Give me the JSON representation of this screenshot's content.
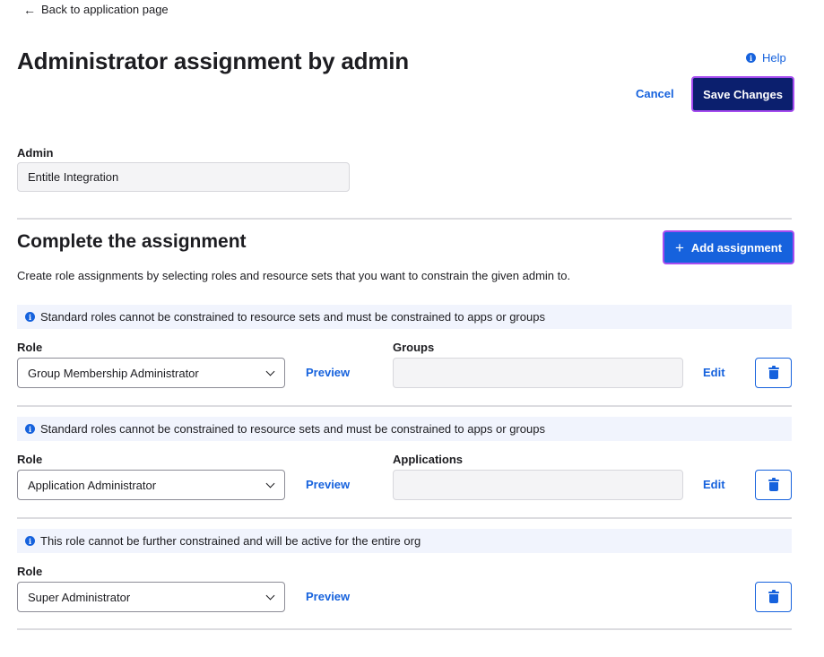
{
  "nav": {
    "back_label": "Back to application page",
    "back_icon": "arrow-left-icon"
  },
  "header": {
    "title": "Administrator assignment by admin",
    "help_label": "Help",
    "help_icon": "info-icon",
    "cancel_label": "Cancel",
    "save_label": "Save Changes"
  },
  "admin": {
    "label": "Admin",
    "value": "Entitle Integration"
  },
  "assignment_section": {
    "title": "Complete the assignment",
    "add_label": "Add assignment",
    "add_icon": "plus-icon",
    "description": "Create role assignments by selecting roles and resource sets that you want to constrain the given admin to."
  },
  "assignments": [
    {
      "banner": "Standard roles cannot be constrained to resource sets and must be constrained to apps or groups",
      "role_label": "Role",
      "role_value": "Group Membership Administrator",
      "preview_label": "Preview",
      "resource_label": "Groups",
      "resource_value": "",
      "edit_label": "Edit",
      "delete_icon": "trash-icon"
    },
    {
      "banner": "Standard roles cannot be constrained to resource sets and must be constrained to apps or groups",
      "role_label": "Role",
      "role_value": "Application Administrator",
      "preview_label": "Preview",
      "resource_label": "Applications",
      "resource_value": "",
      "edit_label": "Edit",
      "delete_icon": "trash-icon"
    },
    {
      "banner": "This role cannot be further constrained and will be active for the entire org",
      "role_label": "Role",
      "role_value": "Super Administrator",
      "preview_label": "Preview",
      "delete_icon": "trash-icon"
    }
  ],
  "colors": {
    "primary_blue": "#1662dd",
    "navy": "#0b1f6e",
    "focus_ring": "#a64cf0",
    "banner_bg": "#f1f4fd",
    "disabled_field_bg": "#f4f4f6"
  }
}
